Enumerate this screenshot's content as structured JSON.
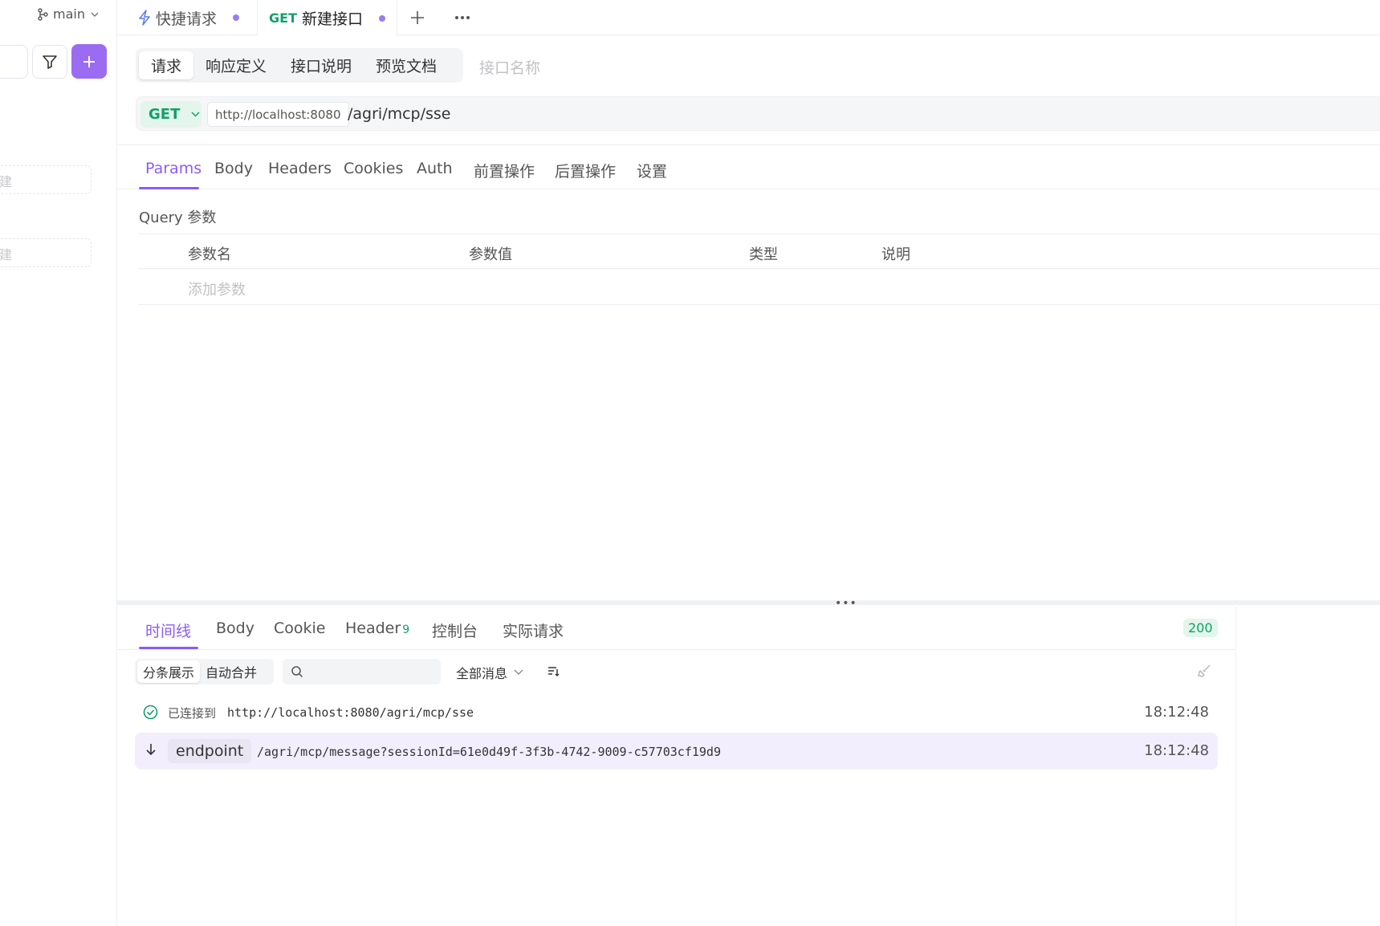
{
  "sidebar": {
    "branch": "main",
    "stub_text_1": "建",
    "stub_text_2": "建"
  },
  "tabs": [
    {
      "label": "快捷请求",
      "method": ""
    },
    {
      "label": "新建接口",
      "method": "GET"
    }
  ],
  "request": {
    "subtabs": [
      "请求",
      "响应定义",
      "接口说明",
      "预览文档"
    ],
    "name_placeholder": "接口名称",
    "method": "GET",
    "base_url": "http://localhost:8080",
    "path": "/agri/mcp/sse",
    "param_tabs": [
      "Params",
      "Body",
      "Headers",
      "Cookies",
      "Auth",
      "前置操作",
      "后置操作",
      "设置"
    ],
    "query_title": "Query 参数",
    "columns": [
      "参数名",
      "参数值",
      "类型",
      "说明"
    ],
    "add_param": "添加参数"
  },
  "response": {
    "tabs": [
      "时间线",
      "Body",
      "Cookie",
      "Header",
      "控制台",
      "实际请求"
    ],
    "header_count": "9",
    "status": "200",
    "view_modes": [
      "分条展示",
      "自动合并"
    ],
    "message_filter": "全部消息",
    "log": [
      {
        "label": "已连接到",
        "text": "http://localhost:8080/agri/mcp/sse",
        "time": "18:12:48"
      },
      {
        "event": "endpoint",
        "text": "/agri/mcp/message?sessionId=61e0d49f-3f3b-4742-9009-c57703cf19d9",
        "time": "18:12:48"
      }
    ]
  },
  "colors": {
    "accent": "#8b5cf6",
    "add_button": "#9b6cf2",
    "get_green": "#12a06b"
  }
}
